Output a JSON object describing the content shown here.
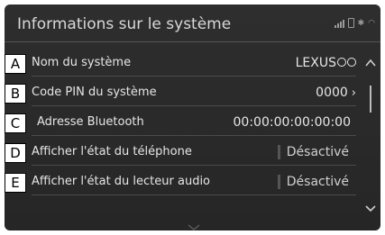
{
  "header": {
    "title": "Informations sur le système"
  },
  "status_icons": [
    "signal-bars-icon",
    "phone-icon",
    "bluetooth-icon",
    "wifi-icon"
  ],
  "rows": [
    {
      "tag": "A",
      "label": "Nom du système",
      "value": "LEXUS"
    },
    {
      "tag": "B",
      "label": "Code PIN du système",
      "value": "0000"
    },
    {
      "tag": "C",
      "label": "Adresse Bluetooth",
      "value": "00:00:00:00:00:00"
    },
    {
      "tag": "D",
      "label": "Afficher l'état du téléphone",
      "value": "Désactivé"
    },
    {
      "tag": "E",
      "label": "Afficher l'état du lecteur audio",
      "value": "Désactivé"
    }
  ]
}
